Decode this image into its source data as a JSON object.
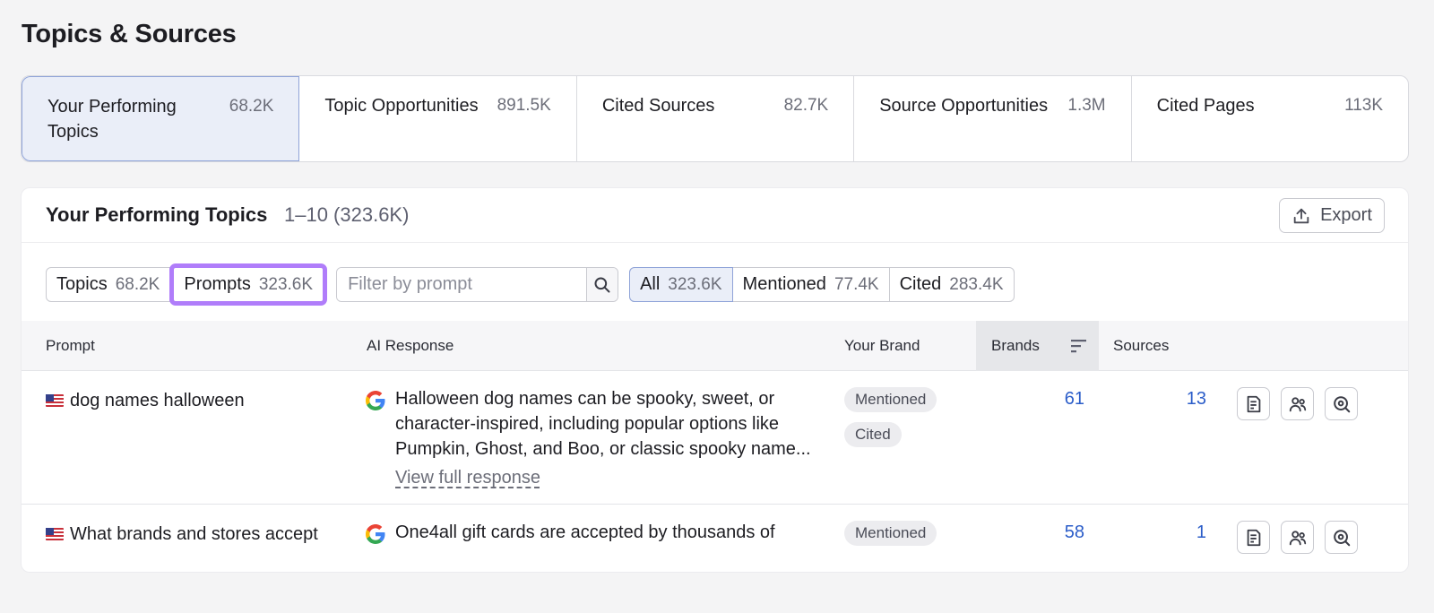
{
  "page_title": "Topics & Sources",
  "tabs": [
    {
      "label": "Your Performing Topics",
      "count": "68.2K"
    },
    {
      "label": "Topic Opportunities",
      "count": "891.5K"
    },
    {
      "label": "Cited Sources",
      "count": "82.7K"
    },
    {
      "label": "Source Opportunities",
      "count": "1.3M"
    },
    {
      "label": "Cited Pages",
      "count": "113K"
    }
  ],
  "panel": {
    "title": "Your Performing Topics",
    "range": "1–10 (323.6K)",
    "export_label": "Export"
  },
  "filters": {
    "view": [
      {
        "label": "Topics",
        "count": "68.2K"
      },
      {
        "label": "Prompts",
        "count": "323.6K"
      }
    ],
    "search_placeholder": "Filter by prompt",
    "status": [
      {
        "label": "All",
        "count": "323.6K"
      },
      {
        "label": "Mentioned",
        "count": "77.4K"
      },
      {
        "label": "Cited",
        "count": "283.4K"
      }
    ]
  },
  "table": {
    "headers": {
      "prompt": "Prompt",
      "ai_response": "AI Response",
      "your_brand": "Your Brand",
      "brands": "Brands",
      "sources": "Sources"
    },
    "rows": [
      {
        "prompt": "dog names halloween",
        "response_lines": [
          "Halloween dog names can be spooky, sweet, or",
          "character‑inspired, including popular options like",
          "Pumpkin, Ghost, and Boo, or classic spooky name..."
        ],
        "view_full": "View full response",
        "badges": [
          "Mentioned",
          "Cited"
        ],
        "brands": "61",
        "sources": "13"
      },
      {
        "prompt": "What brands and stores accept",
        "response_lines": [
          "One4all gift cards are accepted by thousands of"
        ],
        "badges": [
          "Mentioned"
        ],
        "brands": "58",
        "sources": "1"
      }
    ]
  },
  "colors": {
    "accent_blue": "#2b5dc9",
    "highlight_purple": "#b07dfa",
    "active_tab_bg": "#eaeef8"
  },
  "icons": {
    "export": "upload-icon",
    "search": "search-icon",
    "sort": "sort-icon",
    "google": "google-icon",
    "flag": "us-flag-icon",
    "actions": [
      "document-icon",
      "users-icon",
      "search-ai-icon"
    ]
  }
}
